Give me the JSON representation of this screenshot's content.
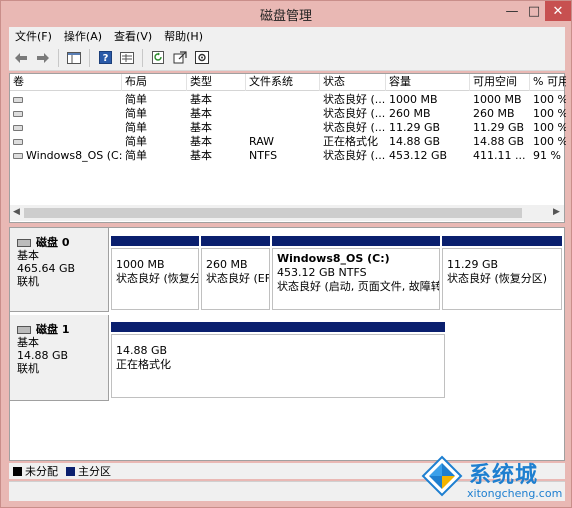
{
  "window": {
    "title": "磁盘管理",
    "minimize": "—",
    "maximize": "□",
    "close": "✕"
  },
  "menu": [
    "文件(F)",
    "操作(A)",
    "查看(V)",
    "帮助(H)"
  ],
  "toolbar": {
    "icons": [
      "back-arrow-icon",
      "forward-arrow-icon",
      "console-tree-icon",
      "help-icon",
      "properties-icon",
      "refresh-icon",
      "export-icon",
      "settings-icon"
    ]
  },
  "volume_list": {
    "columns": [
      "卷",
      "布局",
      "类型",
      "文件系统",
      "状态",
      "容量",
      "可用空间",
      "% 可用"
    ],
    "rows": [
      {
        "volume": "",
        "layout": "简单",
        "type": "基本",
        "fs": "",
        "status": "状态良好 (...",
        "capacity": "1000 MB",
        "free": "1000 MB",
        "pct": "100 %"
      },
      {
        "volume": "",
        "layout": "简单",
        "type": "基本",
        "fs": "",
        "status": "状态良好 (...",
        "capacity": "260 MB",
        "free": "260 MB",
        "pct": "100 %"
      },
      {
        "volume": "",
        "layout": "简单",
        "type": "基本",
        "fs": "",
        "status": "状态良好 (...",
        "capacity": "11.29 GB",
        "free": "11.29 GB",
        "pct": "100 %"
      },
      {
        "volume": "",
        "layout": "简单",
        "type": "基本",
        "fs": "RAW",
        "status": "正在格式化",
        "capacity": "14.88 GB",
        "free": "14.88 GB",
        "pct": "100 %"
      },
      {
        "volume": "Windows8_OS (C:)",
        "layout": "简单",
        "type": "基本",
        "fs": "NTFS",
        "status": "状态良好 (...",
        "capacity": "453.12 GB",
        "free": "411.11 ...",
        "pct": "91 %"
      }
    ]
  },
  "disks": [
    {
      "name": "磁盘 0",
      "type": "基本",
      "size": "465.64 GB",
      "state": "联机",
      "partitions": [
        {
          "name": "",
          "size": "1000 MB",
          "status": "状态良好 (恢复分"
        },
        {
          "name": "",
          "size": "260 MB",
          "status": "状态良好 (EF"
        },
        {
          "name": "Windows8_OS  (C:)",
          "size": "453.12 GB NTFS",
          "status": "状态良好 (启动, 页面文件, 故障转"
        },
        {
          "name": "",
          "size": "11.29 GB",
          "status": "状态良好 (恢复分区)"
        }
      ]
    },
    {
      "name": "磁盘 1",
      "type": "基本",
      "size": "14.88 GB",
      "state": "联机",
      "partitions": [
        {
          "name": "",
          "size": "14.88 GB",
          "status": "正在格式化"
        }
      ]
    }
  ],
  "legend": [
    {
      "label": "未分配",
      "color": "#000000"
    },
    {
      "label": "主分区",
      "color": "#0a1f6e"
    }
  ],
  "watermark": {
    "text": "系统城",
    "url": "xitongcheng.com"
  }
}
